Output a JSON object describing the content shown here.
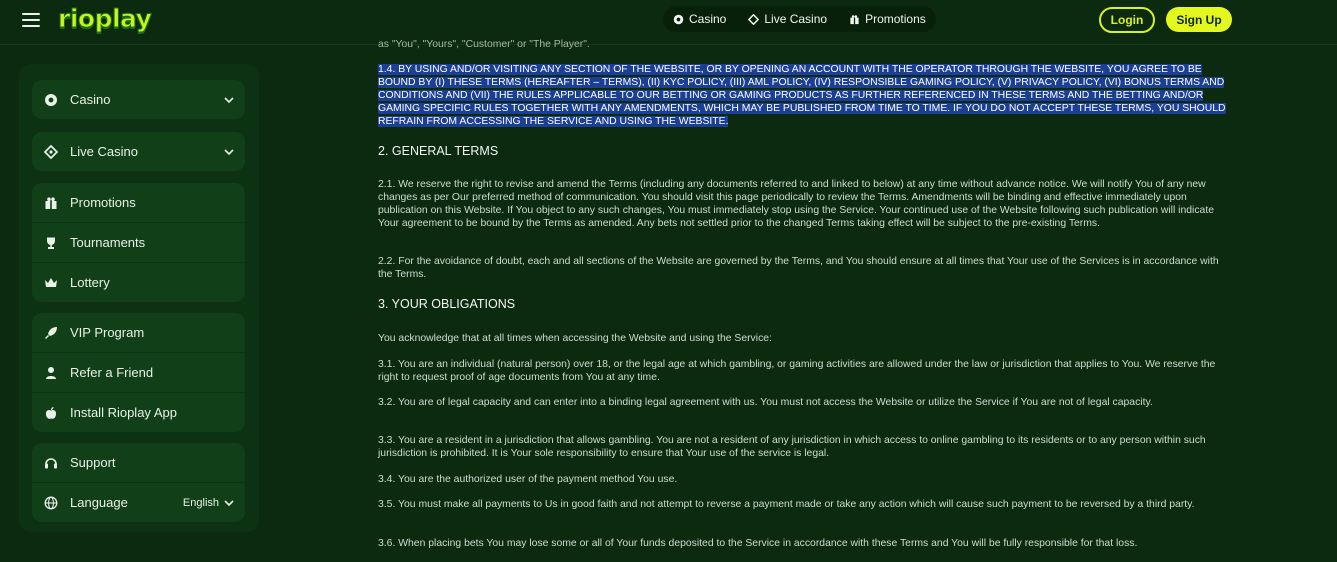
{
  "header": {
    "logo_text": "rioplay",
    "nav": [
      {
        "label": "Casino",
        "icon": "casino-chip-icon"
      },
      {
        "label": "Live Casino",
        "icon": "live-casino-icon"
      },
      {
        "label": "Promotions",
        "icon": "gift-icon"
      }
    ],
    "login_label": "Login",
    "signup_label": "Sign Up"
  },
  "sidebar": {
    "groups": [
      [
        {
          "label": "Casino",
          "icon": "casino-chip-icon",
          "expandable": true
        }
      ],
      [
        {
          "label": "Live Casino",
          "icon": "live-casino-icon",
          "expandable": true
        }
      ],
      [
        {
          "label": "Promotions",
          "icon": "gift-icon"
        },
        {
          "label": "Tournaments",
          "icon": "trophy-icon"
        },
        {
          "label": "Lottery",
          "icon": "crown-icon"
        }
      ],
      [
        {
          "label": "VIP Program",
          "icon": "rocket-icon"
        },
        {
          "label": "Refer a Friend",
          "icon": "person-icon"
        },
        {
          "label": "Install Rioplay App",
          "icon": "apple-icon"
        }
      ],
      [
        {
          "label": "Support",
          "icon": "headset-icon"
        },
        {
          "label": "Language",
          "icon": "globe-icon",
          "value": "English",
          "expandable": true
        }
      ]
    ]
  },
  "content": {
    "cut_line": "as \"You\", \"Yours\", \"Customer\" or \"The Player\".",
    "highlighted": "1.4. BY USING AND/OR VISITING ANY SECTION OF THE WEBSITE, OR BY OPENING AN ACCOUNT WITH THE OPERATOR THROUGH THE WEBSITE, YOU AGREE TO BE BOUND BY (I) THESE TERMS (HEREAFTER – TERMS), (II) KYC POLICY, (III) AML POLICY, (IV) RESPONSIBLE GAMING POLICY, (V) PRIVACY POLICY, (VI) BONUS TERMS AND CONDITIONS AND (VII) THE RULES APPLICABLE TO OUR BETTING OR GAMING PRODUCTS AS FURTHER REFERENCED IN THESE TERMS AND THE BETTING AND/OR GAMING SPECIFIC RULES TOGETHER WITH ANY AMENDMENTS, WHICH MAY BE PUBLISHED FROM TIME TO TIME. IF YOU DO NOT ACCEPT THESE TERMS, YOU SHOULD REFRAIN FROM ACCESSING THE SERVICE AND USING THE WEBSITE.",
    "h_general": "2. GENERAL TERMS",
    "p2_1": "2.1. We reserve the right to revise and amend the Terms (including any documents referred to and linked to below) at any time without advance notice. We will notify You of any new changes as per Our preferred method of communication. You should visit this page periodically to review the Terms. Amendments will be binding and effective immediately upon publication on this Website. If You object to any such changes, You must immediately stop using the Service. Your continued use of the Website following such publication will indicate Your agreement to be bound by the Terms as amended. Any bets not settled prior to the changed Terms taking effect will be subject to the pre-existing Terms.",
    "p2_2": "2.2. For the avoidance of doubt, each and all sections of the Website are governed by the Terms, and You should ensure at all times that Your use of the Services is in accordance with the Terms.",
    "h_obligations": "3. YOUR OBLIGATIONS",
    "p3_intro": "You acknowledge that at all times when accessing the Website and using the Service:",
    "p3_1": "3.1. You are an individual (natural person) over 18, or the legal age at which gambling, or gaming activities are allowed under the law or jurisdiction that applies to You. We reserve the right to request proof of age documents from You at any time.",
    "p3_2": "3.2. You are of legal capacity and can enter into a binding legal agreement with us. You must not access the Website or utilize the Service if You are not of legal capacity.",
    "p3_3": "3.3. You are a resident in a jurisdiction that allows gambling. You are not a resident of any jurisdiction in which access to online gambling to its residents or to any person within such jurisdiction is prohibited. It is Your sole responsibility to ensure that Your use of the service is legal.",
    "p3_4": "3.4. You are the authorized user of the payment method You use.",
    "p3_5": "3.5. You must make all payments to Us in good faith and not attempt to reverse a payment made or take any action which will cause such payment to be reversed by a third party.",
    "p3_6": "3.6. When placing bets You may lose some or all of Your funds deposited to the Service in accordance with these Terms and You will be fully responsible for that loss."
  }
}
